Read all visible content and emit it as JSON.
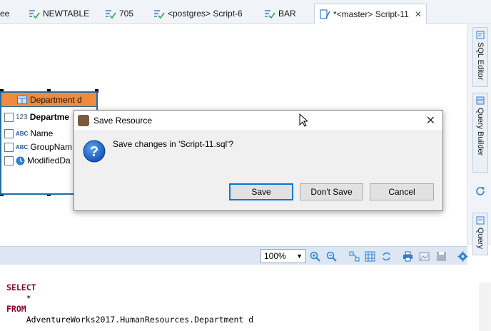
{
  "tabs": [
    {
      "label": "ee"
    },
    {
      "label": "NEWTABLE"
    },
    {
      "label": "705"
    },
    {
      "label": "<postgres> Script-6"
    },
    {
      "label": "BAR"
    },
    {
      "label": "*<master> Script-11"
    }
  ],
  "side_panel": {
    "sql_editor": "SQL Editor",
    "query_builder": "Query Builder",
    "query": "Query"
  },
  "entity": {
    "title": "Department d",
    "fields": [
      {
        "type": "123",
        "name": "Departme"
      },
      {
        "type": "ABC",
        "name": "Name"
      },
      {
        "type": "ABC",
        "name": "GroupNam"
      },
      {
        "type": "clock",
        "name": "ModifiedDa"
      }
    ]
  },
  "toolbar": {
    "zoom": "100%"
  },
  "sql": {
    "lines": [
      "SELECT",
      "    *",
      "FROM",
      "    AdventureWorks2017.HumanResources.Department d"
    ]
  },
  "dialog": {
    "title": "Save Resource",
    "message": "Save changes in 'Script-11.sql'?",
    "save": "Save",
    "dont_save": "Don't Save",
    "cancel": "Cancel"
  },
  "colors": {
    "entity_header": "#f08a3c",
    "entity_border": "#1d6fa5",
    "sql_keyword": "#7f0033",
    "dialog_default_border": "#0078d7"
  }
}
